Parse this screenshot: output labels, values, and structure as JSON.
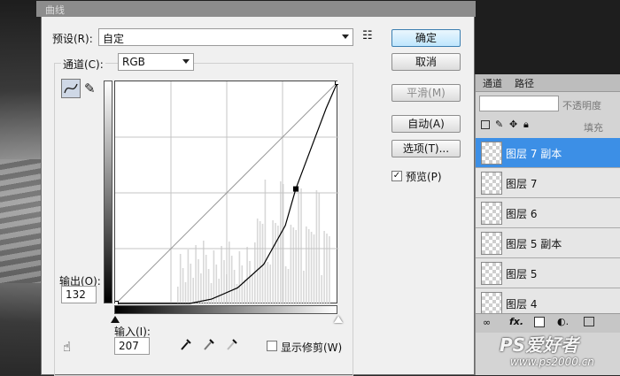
{
  "dialog": {
    "title": "曲线",
    "preset_label": "预设(R):",
    "preset_value": "自定",
    "channel_label": "通道(C):",
    "channel_value": "RGB",
    "output_label": "输出(O):",
    "output_value": "132",
    "input_label": "输入(I):",
    "input_value": "207",
    "show_clipping_label": "显示修剪(W)",
    "preview_label": "预览(P)",
    "preview_checked": true,
    "show_clipping_checked": false,
    "buttons": {
      "ok": "确定",
      "cancel": "取消",
      "smooth": "平滑(M)",
      "auto": "自动(A)",
      "options": "选项(T)..."
    }
  },
  "chart_data": {
    "type": "line",
    "xlim": [
      0,
      255
    ],
    "ylim": [
      0,
      255
    ],
    "grid": "4x4",
    "diagonal_reference": true,
    "curve_points": [
      [
        0,
        0
      ],
      [
        207,
        132
      ],
      [
        255,
        255
      ]
    ],
    "curve_samples": [
      [
        0,
        0
      ],
      [
        85,
        0
      ],
      [
        110,
        5
      ],
      [
        140,
        18
      ],
      [
        170,
        45
      ],
      [
        195,
        90
      ],
      [
        207,
        132
      ],
      [
        225,
        180
      ],
      [
        242,
        225
      ],
      [
        255,
        255
      ]
    ],
    "histogram_note": ""
  },
  "layers_panel": {
    "tabs": [
      "通道",
      "路径"
    ],
    "opacity_label": "不透明度",
    "fill_label": "填充",
    "layers": [
      {
        "name": "图层 7 副本",
        "selected": true
      },
      {
        "name": "图层 7",
        "selected": false
      },
      {
        "name": "图层 6",
        "selected": false
      },
      {
        "name": "图层 5 副本",
        "selected": false
      },
      {
        "name": "图层 5",
        "selected": false
      },
      {
        "name": "图层 4",
        "selected": false
      }
    ]
  },
  "watermark": {
    "brand": "PS爱好者",
    "url": "www.ps2000.cn"
  },
  "colors": {
    "selected_layer": "#3c8fe6",
    "dialog_bg": "#f0f0f0",
    "primary_button": "#bee6fd"
  }
}
